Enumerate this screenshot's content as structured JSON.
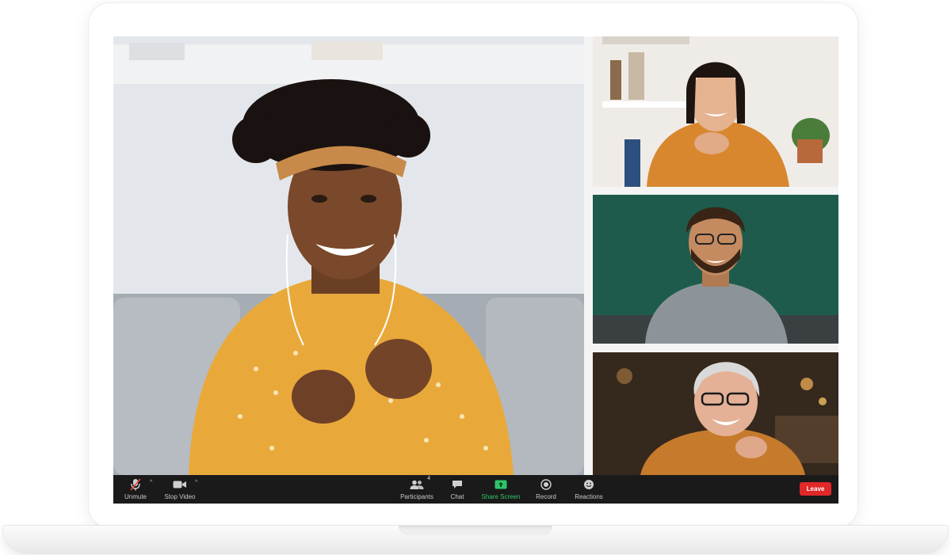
{
  "meeting": {
    "toolbar": {
      "unmute_label": "Unmute",
      "stop_video_label": "Stop Video",
      "participants_label": "Participants",
      "participants_count": "4",
      "chat_label": "Chat",
      "share_screen_label": "Share Screen",
      "record_label": "Record",
      "reactions_label": "Reactions",
      "leave_label": "Leave"
    },
    "icons": {
      "unmute": "muted-microphone-icon",
      "stop_video": "video-camera-icon",
      "participants": "participants-icon",
      "chat": "chat-bubble-icon",
      "share_screen": "share-screen-icon",
      "record": "record-icon",
      "reactions": "reactions-icon"
    },
    "colors": {
      "toolbar_bg": "#1a1a1a",
      "share_accent": "#2ec46a",
      "leave_red": "#e02828"
    }
  }
}
